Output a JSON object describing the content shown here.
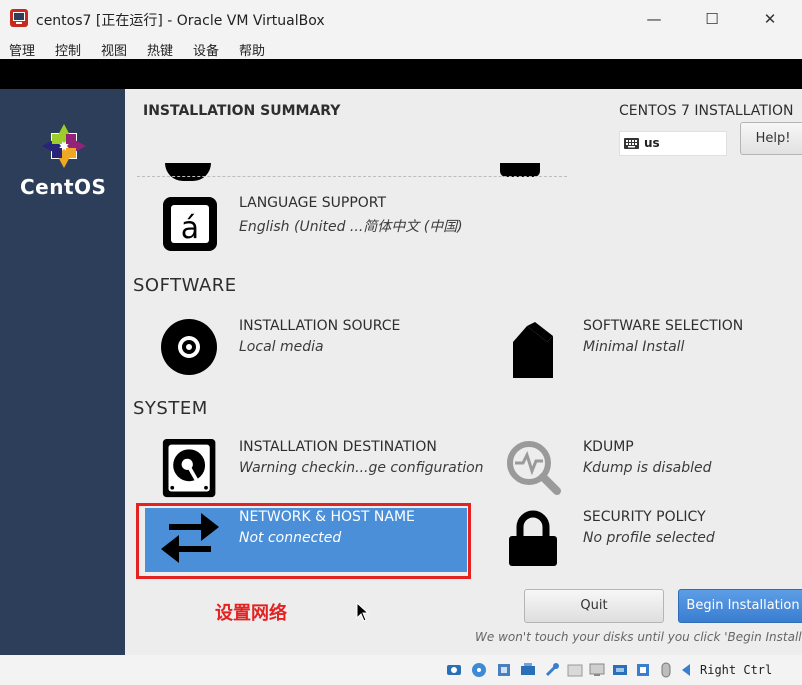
{
  "window": {
    "title": "centos7 [正在运行] - Oracle VM VirtualBox",
    "menu": [
      "管理",
      "控制",
      "视图",
      "热键",
      "设备",
      "帮助"
    ]
  },
  "sidebar": {
    "brand": "CentOS"
  },
  "header": {
    "title": "INSTALLATION SUMMARY",
    "product": "CENTOS 7 INSTALLATION",
    "keyboard_layout": "us",
    "help_label": "Help!"
  },
  "sections": {
    "software": "SOFTWARE",
    "system": "SYSTEM"
  },
  "spokes": {
    "language": {
      "title": "LANGUAGE SUPPORT",
      "status": "English (United ...简体中文 (中国)",
      "icon": "language-icon"
    },
    "source": {
      "title": "INSTALLATION SOURCE",
      "status": "Local media",
      "icon": "disc-icon"
    },
    "software_selection": {
      "title": "SOFTWARE SELECTION",
      "status": "Minimal Install",
      "icon": "package-icon"
    },
    "destination": {
      "title": "INSTALLATION DESTINATION",
      "status": "Warning checkin...ge configuration",
      "icon": "harddisk-icon"
    },
    "kdump": {
      "title": "KDUMP",
      "status": "Kdump is disabled",
      "icon": "kdump-search-icon"
    },
    "network": {
      "title": "NETWORK & HOST NAME",
      "status": "Not connected",
      "icon": "network-arrows-icon"
    },
    "security": {
      "title": "SECURITY POLICY",
      "status": "No profile selected",
      "icon": "lock-icon"
    }
  },
  "annotation": {
    "text": "设置网络",
    "color": "#e42222"
  },
  "buttons": {
    "quit": "Quit",
    "begin": "Begin Installation"
  },
  "footer_note": "We won't touch your disks until you click 'Begin Installation'.",
  "statusbar": {
    "host_key": "Right Ctrl"
  },
  "colors": {
    "sidebar": "#2d3e5a",
    "highlight": "#4a8fd8",
    "annotation_border": "#e42222",
    "begin_button": "#3a7ed0"
  }
}
